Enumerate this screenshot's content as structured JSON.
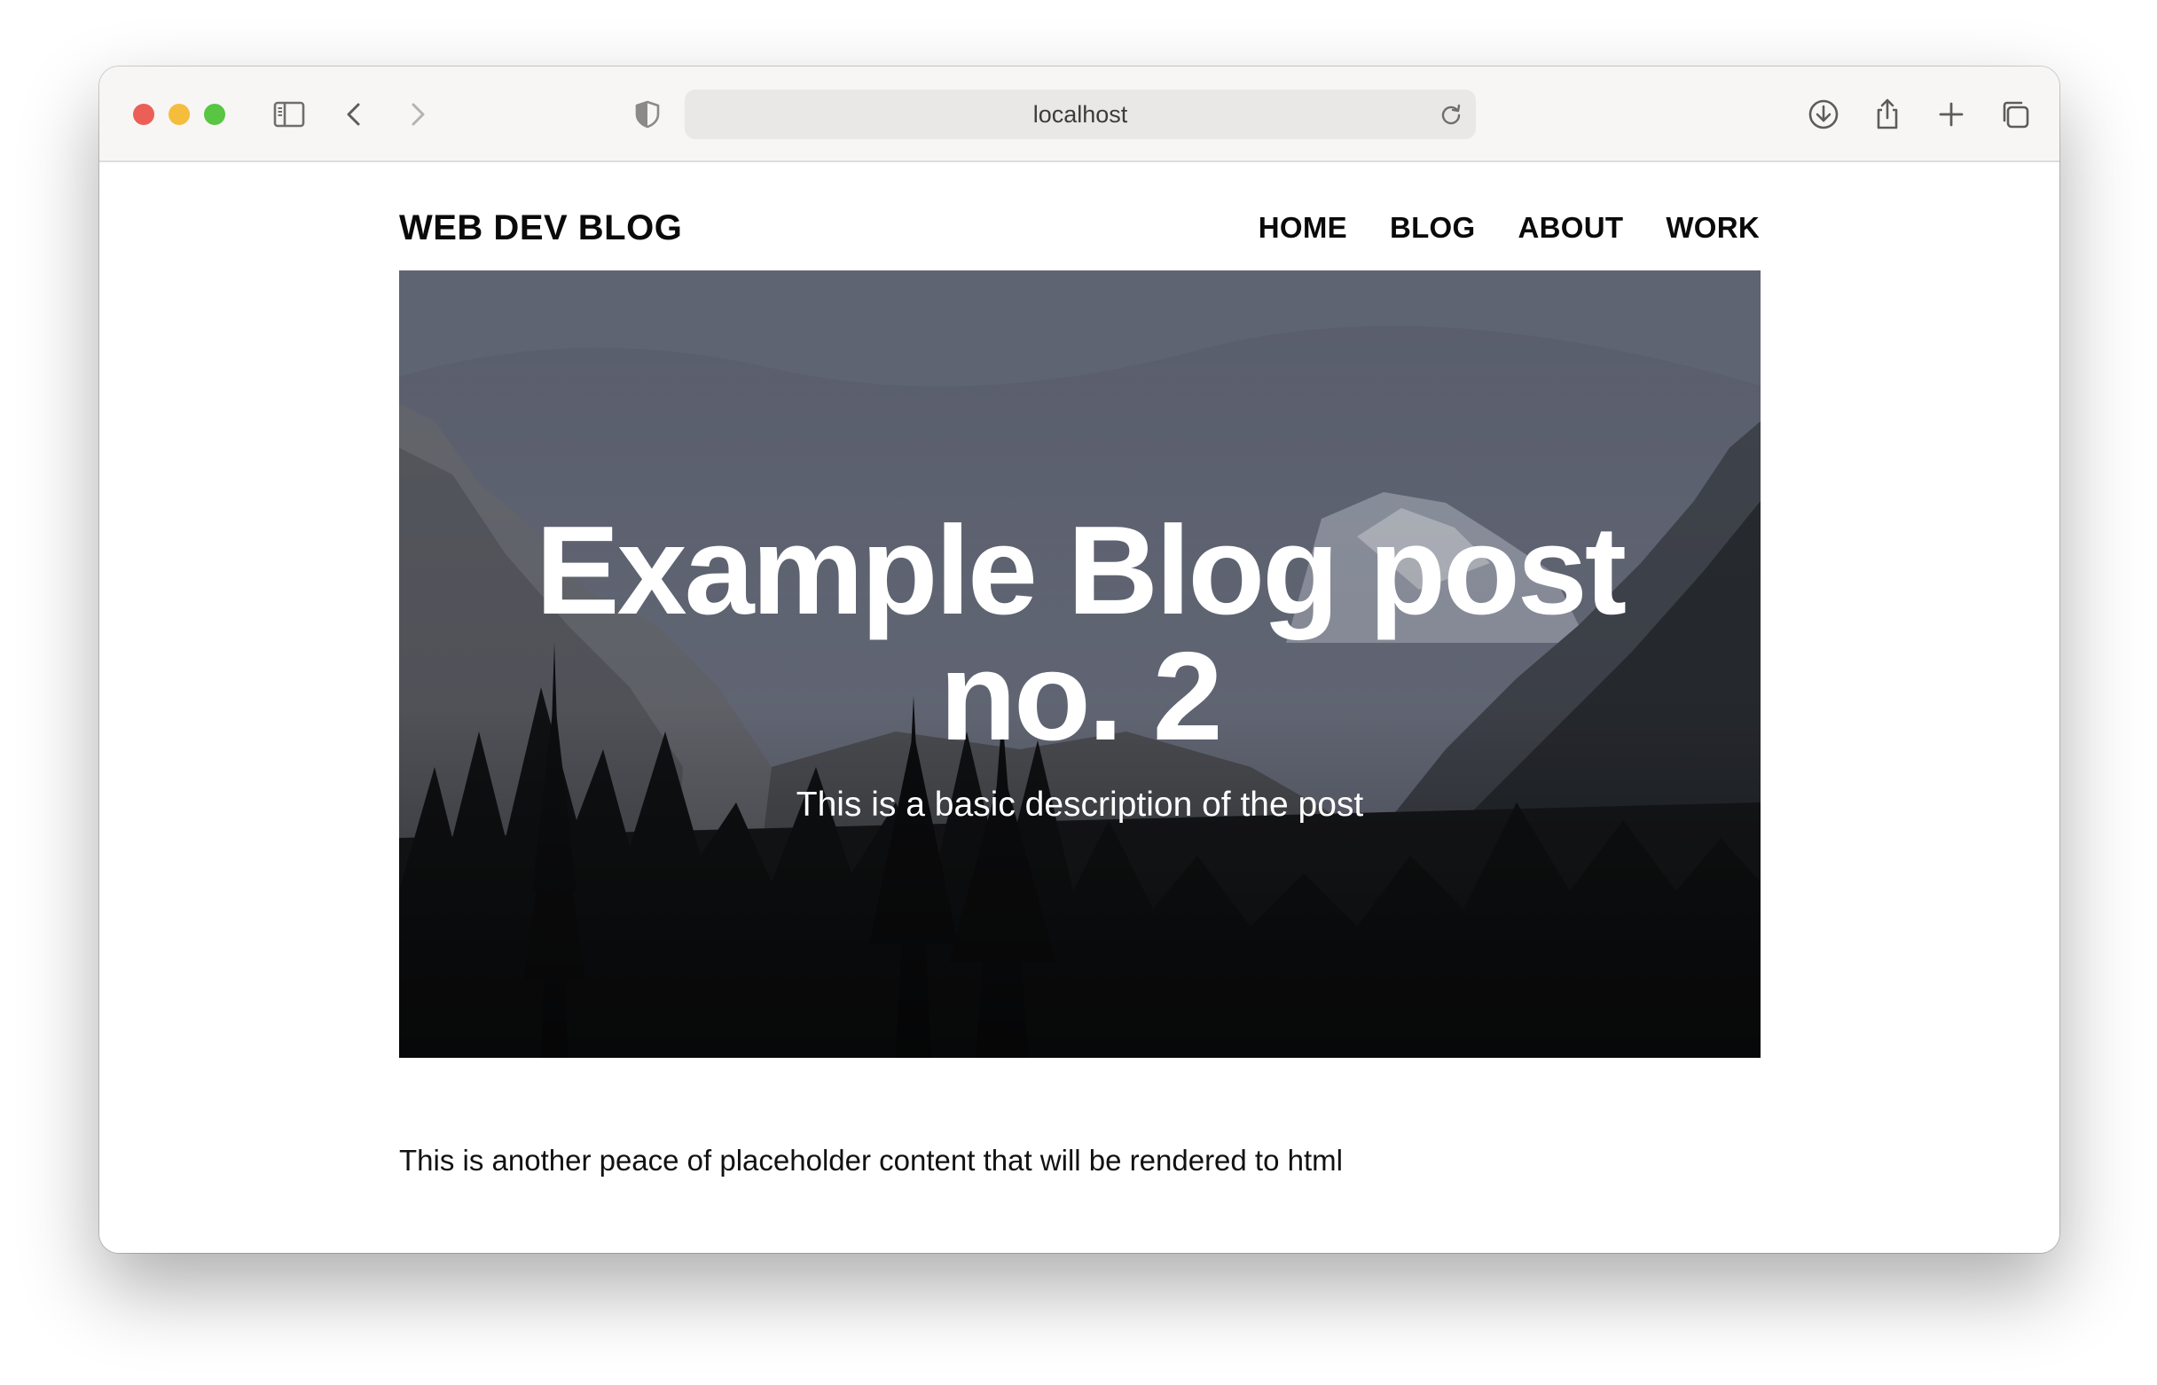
{
  "browser": {
    "url": "localhost",
    "traffic_lights": {
      "close": "#ec5f57",
      "minimize": "#f4bd3c",
      "zoom": "#58c543"
    },
    "toolbar_icons": [
      "sidebar-icon",
      "back-icon",
      "forward-icon",
      "shield-icon",
      "reload-icon",
      "download-icon",
      "share-icon",
      "new-tab-icon",
      "tab-overview-icon"
    ]
  },
  "site": {
    "brand": "WEB DEV BLOG",
    "nav": [
      "HOME",
      "BLOG",
      "ABOUT",
      "WORK"
    ]
  },
  "hero": {
    "title_line1": "Example Blog post",
    "title_line2": "no. 2",
    "description": "This is a basic description of the post"
  },
  "post": {
    "body": "This is another peace of placeholder content that will be rendered to html"
  }
}
